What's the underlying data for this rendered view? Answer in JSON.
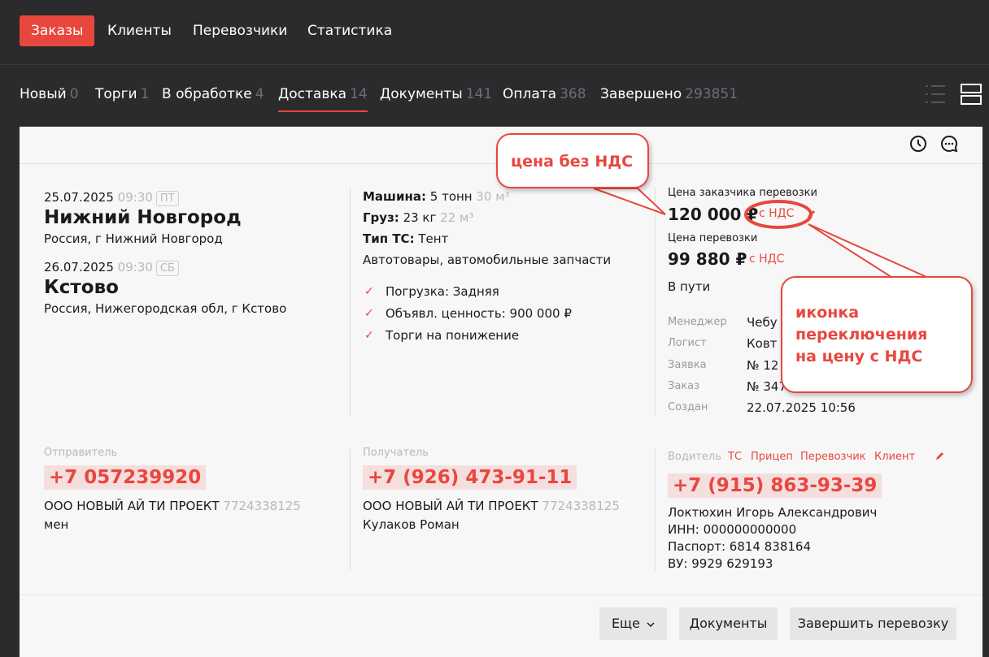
{
  "nav": {
    "items": [
      {
        "label": "Заказы",
        "active": true
      },
      {
        "label": "Клиенты"
      },
      {
        "label": "Перевозчики"
      },
      {
        "label": "Статистика"
      }
    ]
  },
  "tabs": [
    {
      "label": "Новый",
      "count": "0"
    },
    {
      "label": "Торги",
      "count": "1"
    },
    {
      "label": "В обработке",
      "count": "4"
    },
    {
      "label": "Доставка",
      "count": "14",
      "active": true
    },
    {
      "label": "Документы",
      "count": "141"
    },
    {
      "label": "Оплата",
      "count": "368"
    },
    {
      "label": "Завершено",
      "count": "293851"
    }
  ],
  "route": {
    "from": {
      "date": "25.07.2025",
      "time": "09:30",
      "day": "ПТ",
      "city": "Нижний Новгород",
      "address": "Россия, г Нижний Новгород"
    },
    "to": {
      "date": "26.07.2025",
      "time": "09:30",
      "day": "СБ",
      "city": "Кстово",
      "address": "Россия, Нижегородская обл, г Кстово"
    }
  },
  "cargo": {
    "machine_label": "Машина:",
    "machine_value": "5 тонн",
    "machine_volume": "30 м³",
    "cargo_label": "Груз:",
    "cargo_value": "23 кг",
    "cargo_volume": "22 м³",
    "vehicle_label": "Тип ТС:",
    "vehicle_value": "Тент",
    "description": "Автотовары, автомобильные запчасти",
    "checks": [
      "Погрузка: Задняя",
      "Объявл. ценность: 900 000 ₽",
      "Торги на понижение"
    ]
  },
  "pricing": {
    "customer_label": "Цена заказчика перевозки",
    "customer_price": "120 000 ₽",
    "customer_vat": "с НДС",
    "carrier_label": "Цена перевозки",
    "carrier_price": "99 880 ₽",
    "carrier_vat": "с НДС",
    "status": "В пути"
  },
  "details": [
    {
      "label": "Менеджер",
      "value": "Чебу"
    },
    {
      "label": "Логист",
      "value": "Ковт"
    },
    {
      "label": "Заявка",
      "value": "№ 12"
    },
    {
      "label": "Заказ",
      "value": "№ 347"
    },
    {
      "label": "Создан",
      "value": "22.07.2025 10:56"
    }
  ],
  "sender": {
    "label": "Отправитель",
    "phone": "+7 057239920",
    "company": "ООО НОВЫЙ АЙ ТИ ПРОЕКТ",
    "inn": "7724338125",
    "contact": "мен"
  },
  "receiver": {
    "label": "Получатель",
    "phone": "+7 (926) 473-91-11",
    "company": "ООО НОВЫЙ АЙ ТИ ПРОЕКТ",
    "inn": "7724338125",
    "contact": "Кулаков Роман"
  },
  "driver": {
    "links": [
      "Водитель",
      "ТС",
      "Прицеп",
      "Перевозчик",
      "Клиент"
    ],
    "phone": "+7 (915) 863-93-39",
    "name": "Локтюхин Игорь Александрович",
    "inn": "ИНН: 000000000000",
    "passport": "Паспорт: 6814 838164",
    "license": "ВУ: 9929 629193"
  },
  "buttons": {
    "more": "Еще",
    "documents": "Документы",
    "finish": "Завершить перевозку"
  },
  "callouts": {
    "price_no_vat": "цена без НДС",
    "vat_toggle_line1": "иконка",
    "vat_toggle_line2": "переключения",
    "vat_toggle_line3": "на цену с НДС"
  },
  "colors": {
    "accent": "#e8473e",
    "dark_bg": "#2b2b2d",
    "card_bg": "#f7f7f7"
  },
  "icons": [
    "history-icon",
    "chat-icon",
    "list-view-icon",
    "card-view-icon",
    "edit-icon",
    "check-icon",
    "chevron-down-icon"
  ]
}
